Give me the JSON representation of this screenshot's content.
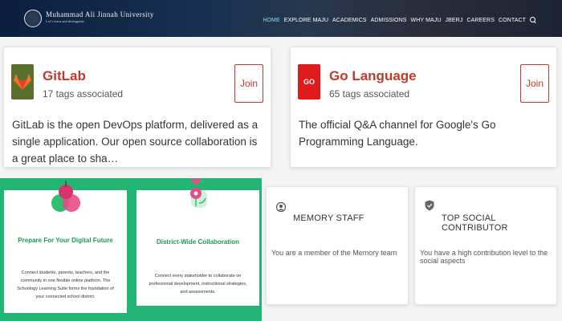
{
  "header": {
    "brand_name": "Muhammad Ali Jinnah University",
    "brand_sub": "Let’s learn and distinguish",
    "nav": [
      "HOME",
      "EXPLORE MAJU",
      "ACADEMICS",
      "ADMISSIONS",
      "WHY MAJU",
      "JBERJ",
      "CAREERS",
      "CONTACT"
    ]
  },
  "collectives": [
    {
      "title": "GitLab",
      "tags": "17 tags associated",
      "join": "Join",
      "description": "GitLab is the open DevOps platform, delivered as a single application. Our open source collaboration is a great place to sha…",
      "icon": "gitlab-icon"
    },
    {
      "title": "Go Language",
      "tags": "65 tags associated",
      "join": "Join",
      "description": "The official Q&A channel for Google's Go Programming Language.",
      "icon": "go-icon"
    }
  ],
  "features": [
    {
      "title": "Prepare For Your Digital Future",
      "text": "Connect students, parents, teachers, and the community in one flexible online platform. The Schoology Learning Suite forms the foundation of your connected school district."
    },
    {
      "title": "District-Wide Collaboration",
      "text": "Connect every stakeholder to collaborate on professional development, instructional strategies, and assessments."
    }
  ],
  "badges": [
    {
      "title": "MEMORY STAFF",
      "description": "You are a member of the Memory team"
    },
    {
      "title": "TOP SOCIAL CONTRIBUTOR",
      "description": "You have a high contribution level to the social aspects"
    }
  ],
  "colors": {
    "accent": "#c0392b",
    "green": "#22b573",
    "nav_active": "#8fd3ff"
  }
}
